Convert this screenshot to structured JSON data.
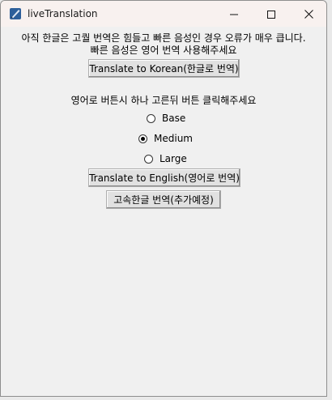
{
  "window": {
    "title": "liveTranslation",
    "icon": "feather-pen-icon"
  },
  "notice": {
    "line1": "아직 한글은 고퀄 번역은 힘들고 빠른 음성인 경우 오류가 매우 큽니다.",
    "line2": "빠른 음성은 영어 번역 사용해주세요"
  },
  "buttons": {
    "to_korean": "Translate to Korean(한글로 번역)",
    "to_english": "Translate to English(영어로 번역)",
    "fast_korean": "고속한글 번역(추가예정)"
  },
  "instruction": "영어로 버튼시 하나 고른뒤 버튼 클릭해주세요",
  "model_options": [
    {
      "label": "Base",
      "checked": false
    },
    {
      "label": "Medium",
      "checked": true
    },
    {
      "label": "Large",
      "checked": false
    }
  ]
}
